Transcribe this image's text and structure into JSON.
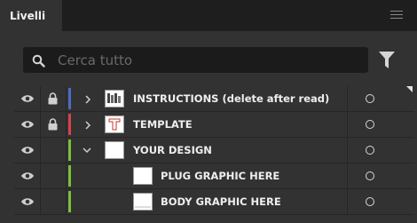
{
  "panel": {
    "tab_label": "Livelli",
    "menu_icon": "hamburger-menu-icon"
  },
  "search": {
    "placeholder": "Cerca tutto",
    "value": ""
  },
  "colors": {
    "instructions_layer": "#4a6cc9",
    "template_layer": "#d9434a",
    "design_layer": "#7bbf3a"
  },
  "layers": [
    {
      "name": "INSTRUCTIONS (delete after read)",
      "visible": true,
      "locked": true,
      "expanded": false,
      "color": "#4a6cc9"
    },
    {
      "name": "TEMPLATE",
      "visible": true,
      "locked": true,
      "expanded": false,
      "color": "#d9434a"
    },
    {
      "name": "YOUR DESIGN",
      "visible": true,
      "locked": false,
      "expanded": true,
      "color": "#7bbf3a"
    },
    {
      "name": "PLUG GRAPHIC HERE",
      "visible": true,
      "locked": false,
      "parent": "YOUR DESIGN",
      "color": "#7bbf3a"
    },
    {
      "name": "BODY GRAPHIC HERE",
      "visible": true,
      "locked": false,
      "parent": "YOUR DESIGN",
      "color": "#7bbf3a"
    }
  ]
}
